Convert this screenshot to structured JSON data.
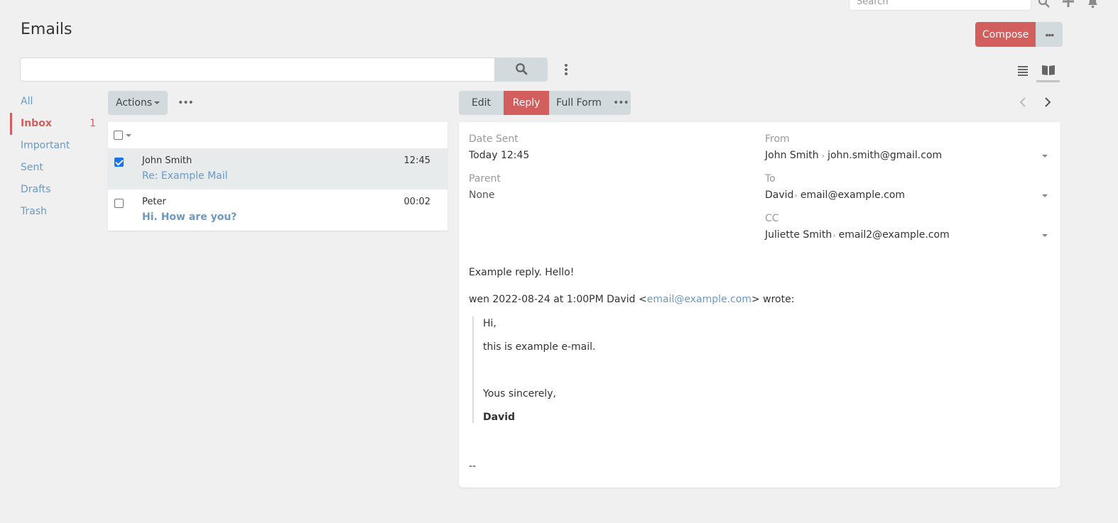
{
  "navbar": {
    "search_placeholder": "Search",
    "icons": [
      "search-icon",
      "plus-icon",
      "bell-icon"
    ]
  },
  "page": {
    "title": "Emails",
    "compose_label": "Compose",
    "more_label": "•••",
    "search_value": "",
    "search_placeholder": ""
  },
  "folders": [
    {
      "label": "All",
      "count": "",
      "active": false
    },
    {
      "label": "Inbox",
      "count": "1",
      "active": true
    },
    {
      "label": "Important",
      "count": "",
      "active": false
    },
    {
      "label": "Sent",
      "count": "",
      "active": false
    },
    {
      "label": "Drafts",
      "count": "",
      "active": false
    },
    {
      "label": "Trash",
      "count": "",
      "active": false
    }
  ],
  "list": {
    "actions_label": "Actions",
    "more_label": "•••",
    "rows": [
      {
        "sender": "John Smith",
        "subject": "Re: Example Mail",
        "time": "12:45",
        "checked": true,
        "unread": false
      },
      {
        "sender": "Peter",
        "subject": "Hi. How are you?",
        "time": "00:02",
        "checked": false,
        "unread": true
      }
    ]
  },
  "detail": {
    "buttons": {
      "edit": "Edit",
      "reply": "Reply",
      "full_form": "Full Form",
      "more": "•••"
    },
    "fields": {
      "date_sent_label": "Date Sent",
      "date_sent_value": "Today 12:45",
      "parent_label": "Parent",
      "parent_value": "None",
      "from_label": "From",
      "from_name": "John Smith",
      "from_email": "john.smith@gmail.com",
      "to_label": "To",
      "to_name": "David",
      "to_email": "email@example.com",
      "cc_label": "CC",
      "cc_name": "Juliette Smith",
      "cc_email": "email2@example.com"
    },
    "body": {
      "line1": "Example reply. Hello!",
      "quote_intro_prefix": "wen 2022-08-24 at 1:00PM David <",
      "quote_intro_link": "email@example.com",
      "quote_intro_suffix": "> wrote:",
      "quote_lines": [
        "Hi,",
        "this is example e-mail.",
        "Yous sincerely,",
        "David"
      ],
      "signature": "--"
    }
  },
  "colors": {
    "accent": "#d35e5e",
    "link": "#6b99c3",
    "button_gray": "#d2dadd",
    "background": "#f0f0f0"
  }
}
